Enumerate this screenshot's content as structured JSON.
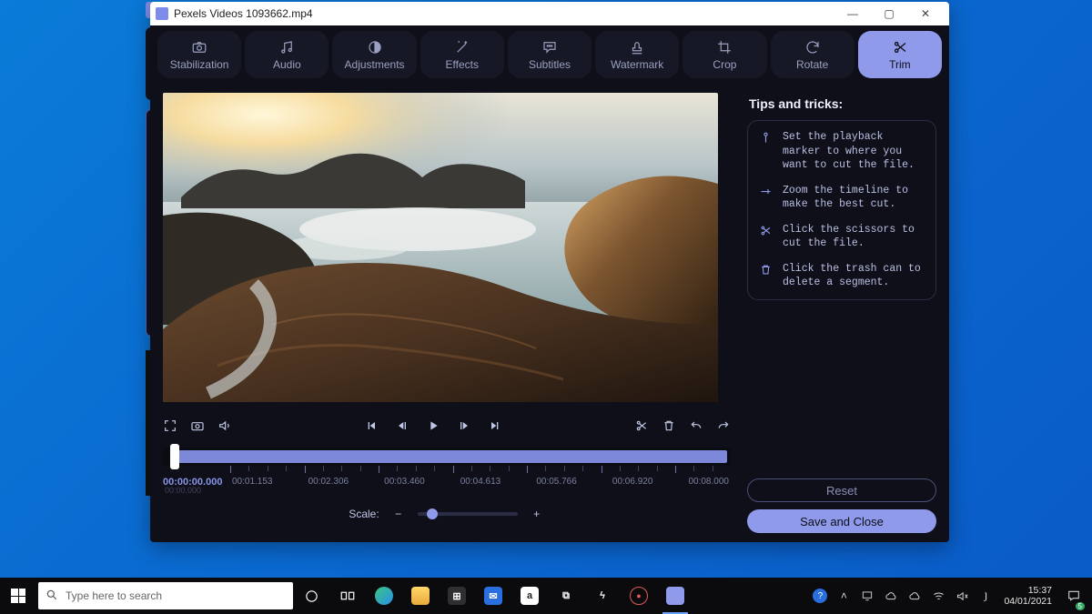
{
  "window": {
    "title": "Pexels Videos 1093662.mp4",
    "min": "—",
    "max": "▢",
    "close": "✕"
  },
  "tabs": [
    {
      "label": "Stabilization",
      "icon": "camera"
    },
    {
      "label": "Audio",
      "icon": "music"
    },
    {
      "label": "Adjustments",
      "icon": "contrast"
    },
    {
      "label": "Effects",
      "icon": "wand"
    },
    {
      "label": "Subtitles",
      "icon": "chat"
    },
    {
      "label": "Watermark",
      "icon": "stamp"
    },
    {
      "label": "Crop",
      "icon": "crop"
    },
    {
      "label": "Rotate",
      "icon": "rotate"
    },
    {
      "label": "Trim",
      "icon": "scissors",
      "active": true
    }
  ],
  "timeline": {
    "playhead": "00:00:00.000",
    "alt_start": "00:00.000",
    "ticks": [
      "00:01.153",
      "00:02.306",
      "00:03.460",
      "00:04.613",
      "00:05.766",
      "00:06.920",
      "00:08.000"
    ],
    "scale_label": "Scale:",
    "scale_minus": "−",
    "scale_plus": "+"
  },
  "tips": {
    "title": "Tips and tricks:",
    "items": [
      {
        "icon": "marker",
        "text": "Set the playback marker to where you want to cut the file."
      },
      {
        "icon": "zoom",
        "text": "Zoom the timeline to make the best cut."
      },
      {
        "icon": "scissors",
        "text": "Click the scissors to cut the file."
      },
      {
        "icon": "trash",
        "text": "Click the trash can to delete a segment."
      }
    ]
  },
  "buttons": {
    "reset": "Reset",
    "save": "Save and Close"
  },
  "taskbar": {
    "search_placeholder": "Type here to search",
    "time": "15:37",
    "date": "04/01/2021",
    "notif_count": "5"
  }
}
